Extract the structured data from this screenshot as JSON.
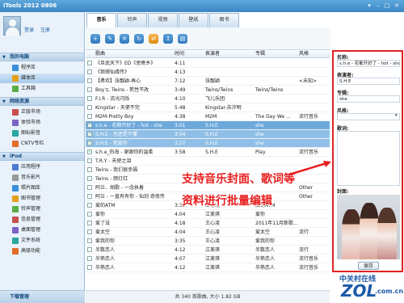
{
  "app": {
    "title": "iTools 2012 0806"
  },
  "tabs": [
    "音乐",
    "铃声",
    "视频",
    "壁纸",
    "图书"
  ],
  "user": {
    "login": "登录",
    "register": "注册"
  },
  "sidebar": {
    "sections": [
      {
        "label": "我的电脑",
        "items": [
          {
            "label": "程序库"
          },
          {
            "label": "媒体库"
          },
          {
            "label": "工具箱"
          }
        ]
      },
      {
        "label": "网络资源",
        "items": [
          {
            "label": "正版市场"
          },
          {
            "label": "体验市场"
          },
          {
            "label": "图标影音"
          },
          {
            "label": "CNTV专栏"
          }
        ]
      },
      {
        "label": "iPod",
        "items": [
          {
            "label": "应用程序"
          },
          {
            "label": "音乐影片"
          },
          {
            "label": "照片图库"
          },
          {
            "label": "图书管理"
          },
          {
            "label": "铃声管理"
          },
          {
            "label": "信息管理"
          },
          {
            "label": "桌面管理"
          },
          {
            "label": "文件系统"
          },
          {
            "label": "高级功能"
          }
        ]
      }
    ],
    "bottom": "下载管理"
  },
  "table": {
    "columns": [
      "歌曲",
      "时间",
      "表演者",
      "专辑",
      "风格"
    ],
    "rows": [
      {
        "song": "《旦武天下》ED《思寄乡》",
        "time": "4:11",
        "artist": "",
        "album": "",
        "genre": ""
      },
      {
        "song": "《琅琊仙缘传》",
        "time": "4:13",
        "artist": "",
        "album": "",
        "genre": ""
      },
      {
        "song": "【勇欢】张靓颖-再心",
        "time": "7:12",
        "artist": "张靓颖",
        "album": "",
        "genre": "<未知>"
      },
      {
        "song": "Boy'z, Twins - 死性不改",
        "time": "3:49",
        "artist": "Twins/Twins",
        "album": "Twins/Twins",
        "genre": ""
      },
      {
        "song": "F.I.R - 流光闪烁",
        "time": "4:10",
        "artist": "飞儿乐团",
        "album": "",
        "genre": ""
      },
      {
        "song": "Kingstar - 天使不完",
        "time": "5:48",
        "artist": "Kingstar-苏汐明",
        "album": "",
        "genre": ""
      },
      {
        "song": "M2M-Pretty Boy",
        "time": "4:38",
        "artist": "M2M",
        "album": "The Day We ...",
        "genre": "流行音乐"
      },
      {
        "song": "s.h.e - 花都开好了 - hot - she",
        "time": "3:01",
        "artist": "S.H.E",
        "album": "she",
        "genre": ""
      },
      {
        "song": "S.H.E - 也还是不懂",
        "time": "3:54",
        "artist": "S.H.E",
        "album": "she",
        "genre": ""
      },
      {
        "song": "S.H.E - 我爱你",
        "time": "3:27",
        "artist": "S.H.E",
        "album": "she",
        "genre": ""
      },
      {
        "song": "s.h.e_热海 - 谢谢你的温柔",
        "time": "3:58",
        "artist": "S.H.E",
        "album": "Play",
        "genre": "流行音乐"
      },
      {
        "song": "T.R.Y - 天使之泪",
        "time": "",
        "artist": "",
        "album": "",
        "genre": ""
      },
      {
        "song": "Twins - 我们很幸福",
        "time": "",
        "artist": "",
        "album": "",
        "genre": ""
      },
      {
        "song": "Twins - 颜灯红",
        "time": "",
        "artist": "",
        "album": "",
        "genre": ""
      },
      {
        "song": "阿兰、胡歌 - 一念执着",
        "time": "",
        "artist": "",
        "album": "",
        "genre": "Other"
      },
      {
        "song": "阿兰 - 一直有有你 - 仙剑 奇侠传",
        "time": "",
        "artist": "",
        "album": "",
        "genre": "Other"
      },
      {
        "song": "爱的ATM",
        "time": "3:35",
        "artist": "王心凌",
        "album": "爱的ATM",
        "genre": ""
      },
      {
        "song": "爱你",
        "time": "4:04",
        "artist": "江美琪",
        "album": "爱你",
        "genre": ""
      },
      {
        "song": "爱了没",
        "time": "4:18",
        "artist": "王心凌",
        "album": "2011年11月新歌...",
        "genre": ""
      },
      {
        "song": "爱太空",
        "time": "4:04",
        "artist": "王心凌",
        "album": "爱太空",
        "genre": "流行"
      },
      {
        "song": "爱我的你",
        "time": "3:35",
        "artist": "王心凌",
        "album": "爱我的你",
        "genre": ""
      },
      {
        "song": "半数恋人",
        "time": "4:12",
        "artist": "江美琪",
        "album": "半数恋人",
        "genre": "流行"
      },
      {
        "song": "半熟恋人",
        "time": "4:07",
        "artist": "江美琪",
        "album": "半熟恋人",
        "genre": "流行音乐"
      },
      {
        "song": "半熟恋人",
        "time": "4:12",
        "artist": "江美琪",
        "album": "半熟恋人",
        "genre": "流行音乐"
      }
    ]
  },
  "status": "共 340 首歌曲, 大小 1.82 GB",
  "panel": {
    "name_label": "名称:",
    "name_value": "s.h.e - 花都开好了 - hot - she",
    "artist_label": "表演者:",
    "artist_value": "S.H.E",
    "album_label": "专辑:",
    "album_value": "she",
    "genre_label": "风格:",
    "genre_value": "",
    "lyrics_label": "歌词:",
    "cover_label": "封面:",
    "save_label": "保存"
  },
  "overlay": {
    "line1": "支持音乐封面、歌词等",
    "line2": "资料进行批量编辑"
  },
  "watermark": {
    "cn": "中关村在线",
    "zol": "ZOL",
    "domain": ".com.cn"
  }
}
